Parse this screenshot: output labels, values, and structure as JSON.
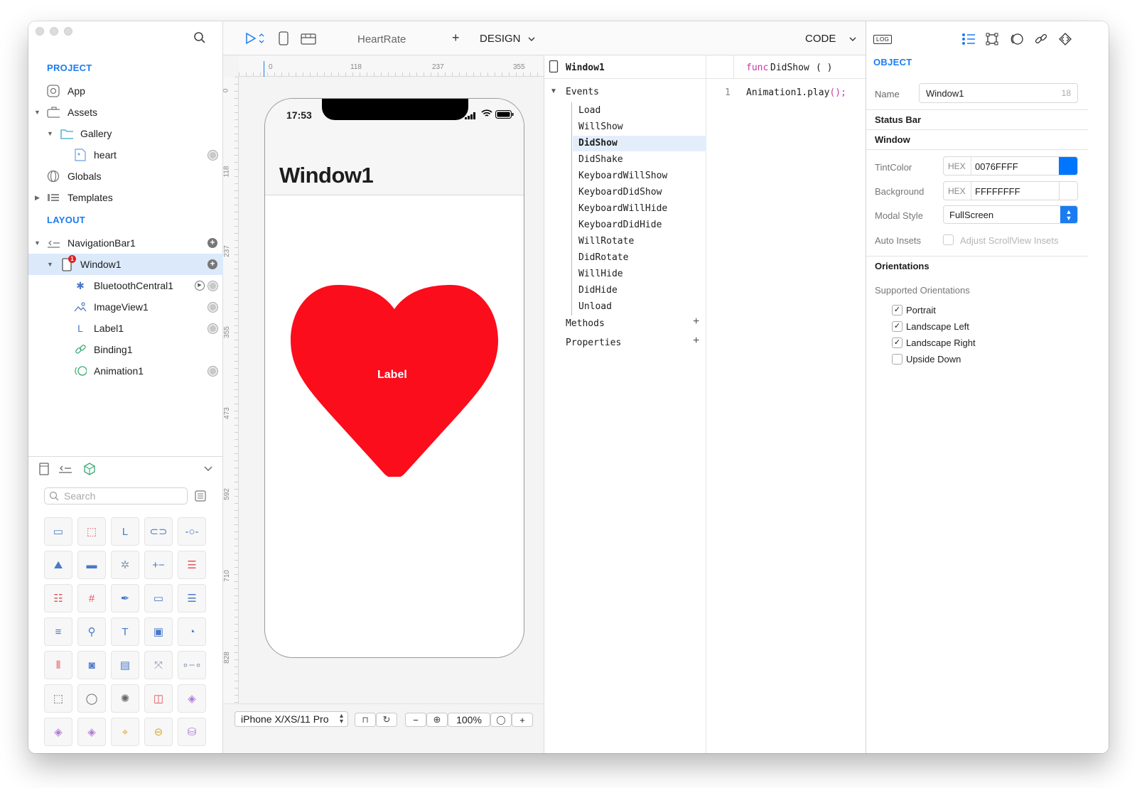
{
  "project": {
    "section_label": "PROJECT",
    "items": [
      {
        "label": "App"
      },
      {
        "label": "Assets"
      },
      {
        "label": "Gallery"
      },
      {
        "label": "heart"
      },
      {
        "label": "Globals"
      },
      {
        "label": "Templates"
      }
    ]
  },
  "layout": {
    "section_label": "LAYOUT",
    "items": [
      {
        "label": "NavigationBar1"
      },
      {
        "label": "Window1",
        "badge": "1"
      },
      {
        "label": "BluetoothCentral1"
      },
      {
        "label": "ImageView1"
      },
      {
        "label": "Label1"
      },
      {
        "label": "Binding1"
      },
      {
        "label": "Animation1"
      }
    ]
  },
  "library": {
    "search_placeholder": "Search",
    "tiles": [
      {
        "icon": "button-icon",
        "glyph": "▭",
        "color": "#4a79c8"
      },
      {
        "icon": "view-icon",
        "glyph": "⬚",
        "color": "#e0555e"
      },
      {
        "icon": "label-icon",
        "glyph": "L",
        "color": "#4a79c8"
      },
      {
        "icon": "toggle-icon",
        "glyph": "⊂⊃",
        "color": "#4a79c8"
      },
      {
        "icon": "slider-icon",
        "glyph": "-○-",
        "color": "#4a79c8"
      },
      {
        "icon": "image-icon",
        "glyph": "⛰",
        "color": "#4a79c8"
      },
      {
        "icon": "progress-icon",
        "glyph": "▬",
        "color": "#4a79c8"
      },
      {
        "icon": "spinner-icon",
        "glyph": "✲",
        "color": "#8a9ab8"
      },
      {
        "icon": "stepper-icon",
        "glyph": "+−",
        "color": "#4a79c8"
      },
      {
        "icon": "segmented-icon",
        "glyph": "☰",
        "color": "#e0555e"
      },
      {
        "icon": "table-icon",
        "glyph": "☷",
        "color": "#e0555e"
      },
      {
        "icon": "grid-icon",
        "glyph": "#",
        "color": "#e0555e"
      },
      {
        "icon": "pen-icon",
        "glyph": "✒",
        "color": "#4a79c8"
      },
      {
        "icon": "textfield-icon",
        "glyph": "▭",
        "color": "#4a79c8"
      },
      {
        "icon": "picker-icon",
        "glyph": "☰",
        "color": "#4a79c8"
      },
      {
        "icon": "textview-icon",
        "glyph": "≡",
        "color": "#4a79c8"
      },
      {
        "icon": "searchbar-icon",
        "glyph": "⚲",
        "color": "#4a79c8"
      },
      {
        "icon": "text-icon",
        "glyph": "T",
        "color": "#4a79c8"
      },
      {
        "icon": "webview-icon",
        "glyph": "▣",
        "color": "#4a79c8"
      },
      {
        "icon": "chart-icon",
        "glyph": "◔",
        "color": "#4a79c8"
      },
      {
        "icon": "carousel-icon",
        "glyph": "⦀",
        "color": "#e0555e"
      },
      {
        "icon": "camera-icon",
        "glyph": "◙",
        "color": "#4a79c8"
      },
      {
        "icon": "video-icon",
        "glyph": "▤",
        "color": "#4a79c8"
      },
      {
        "icon": "connector-icon",
        "glyph": "⤧",
        "color": "#8a9ab8"
      },
      {
        "icon": "link-icon",
        "glyph": "∘−∘",
        "color": "#8a9ab8"
      },
      {
        "icon": "frame-icon",
        "glyph": "⬚",
        "color": "#666"
      },
      {
        "icon": "watch-icon",
        "glyph": "◯",
        "color": "#666"
      },
      {
        "icon": "gear-icon",
        "glyph": "✺",
        "color": "#666"
      },
      {
        "icon": "split-icon",
        "glyph": "◫",
        "color": "#e0555e"
      },
      {
        "icon": "layers-icon",
        "glyph": "◈",
        "color": "#b07ad8"
      },
      {
        "icon": "stack-icon",
        "glyph": "◈",
        "color": "#b07ad8"
      },
      {
        "icon": "stack2-icon",
        "glyph": "◈",
        "color": "#b07ad8"
      },
      {
        "icon": "location-icon",
        "glyph": "⌖",
        "color": "#d8a83a"
      },
      {
        "icon": "orbit-icon",
        "glyph": "⊖",
        "color": "#d8a83a"
      },
      {
        "icon": "database-icon",
        "glyph": "⛁",
        "color": "#b07ad8"
      }
    ]
  },
  "toolbar": {
    "title": "HeartRate",
    "add_label": "+",
    "design_label": "DESIGN",
    "code_label": "CODE"
  },
  "canvas": {
    "ruler_top": [
      "0",
      "118",
      "237",
      "355"
    ],
    "ruler_left": [
      "0",
      "118",
      "237",
      "355",
      "473",
      "592",
      "710",
      "828"
    ],
    "status_time": "17:53",
    "nav_title": "Window1",
    "heart_label": "Label",
    "heart_color": "#fb0d1c"
  },
  "bottom_bar": {
    "device": "iPhone X/XS/11 Pro",
    "zoom_minus": "−",
    "zoom": "100%",
    "zoom_plus": "+"
  },
  "code_outline": {
    "object": "Window1",
    "events_label": "Events",
    "events": [
      "Load",
      "WillShow",
      "DidShow",
      "DidShake",
      "KeyboardWillShow",
      "KeyboardDidShow",
      "KeyboardWillHide",
      "KeyboardDidHide",
      "WillRotate",
      "DidRotate",
      "WillHide",
      "DidHide",
      "Unload"
    ],
    "selected_event": "DidShow",
    "methods_label": "Methods",
    "properties_label": "Properties",
    "add": "+"
  },
  "editor": {
    "func_keyword": "func",
    "func_name": "DidShow",
    "func_parens": "(  )",
    "line_number": "1",
    "code_obj": "Animation1",
    "code_call": ".play",
    "code_args": "();"
  },
  "inspector": {
    "log_label": "LOG",
    "object_label": "OBJECT",
    "name_label": "Name",
    "name_value": "Window1",
    "name_count": "18",
    "statusbar_header": "Status Bar",
    "window_header": "Window",
    "tint_label": "TintColor",
    "tint_prefix": "HEX",
    "tint_value": "0076FFFF",
    "tint_color": "#0076ff",
    "bg_label": "Background",
    "bg_prefix": "HEX",
    "bg_value": "FFFFFFFF",
    "bg_color": "#ffffff",
    "modal_label": "Modal Style",
    "modal_value": "FullScreen",
    "insets_label": "Auto Insets",
    "insets_option": "Adjust ScrollView Insets",
    "orientations_header": "Orientations",
    "supported_label": "Supported Orientations",
    "orientations": [
      {
        "label": "Portrait",
        "checked": true
      },
      {
        "label": "Landscape Left",
        "checked": true
      },
      {
        "label": "Landscape Right",
        "checked": true
      },
      {
        "label": "Upside Down",
        "checked": false
      }
    ]
  }
}
